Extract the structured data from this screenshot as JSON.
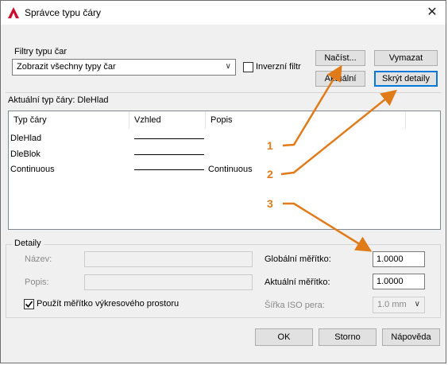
{
  "window": {
    "title": "Správce typu čáry",
    "close_glyph": "✕",
    "icon": "autocad-logo-icon"
  },
  "filters": {
    "group_label": "Filtry typu čar",
    "combo_value": "Zobrazit všechny typy čar",
    "inverse_label": "Inverzní filtr",
    "inverse_checked": false
  },
  "buttons": {
    "load": "Načíst...",
    "delete": "Vymazat",
    "current": "Aktuální",
    "hide_details": "Skrýt detaily",
    "ok": "OK",
    "cancel": "Storno",
    "help": "Nápověda"
  },
  "current_linetype": "Aktuální typ čáry:  DleHlad",
  "table": {
    "columns": [
      "Typ čáry",
      "Vzhled",
      "Popis"
    ],
    "rows": [
      {
        "name": "DleHlad",
        "description": ""
      },
      {
        "name": "DleBlok",
        "description": ""
      },
      {
        "name": "Continuous",
        "description": "Continuous"
      }
    ]
  },
  "details": {
    "group_label": "Detaily",
    "name_label": "Název:",
    "desc_label": "Popis:",
    "paper_space_label": "Použít měřítko výkresového prostoru",
    "paper_space_checked": true,
    "global_scale_label": "Globální měřítko:",
    "global_scale_value": "1.0000",
    "current_scale_label": "Aktuální měřítko:",
    "current_scale_value": "1.0000",
    "iso_pen_label": "Šířka ISO pera:",
    "iso_pen_value": "1.0 mm"
  },
  "callouts": [
    "1",
    "2",
    "3"
  ],
  "colors": {
    "callout": "#e07b1a",
    "accent": "#0078d7"
  }
}
